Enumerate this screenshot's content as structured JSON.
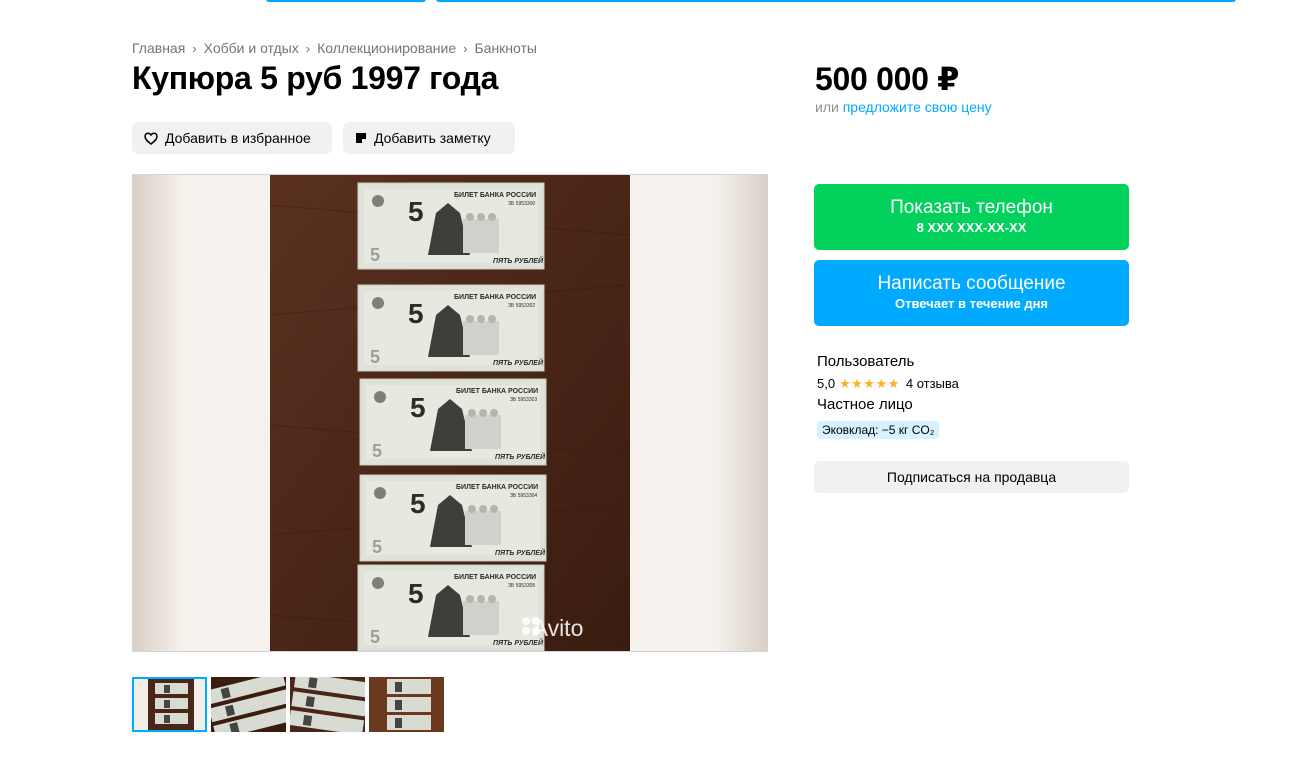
{
  "breadcrumb": [
    {
      "label": "Главная"
    },
    {
      "label": "Хобби и отдых"
    },
    {
      "label": "Коллекционирование"
    },
    {
      "label": "Банкноты"
    }
  ],
  "listing": {
    "title": "Купюра 5 руб 1997 года",
    "price": "500 000 ₽",
    "offer_prefix": "или",
    "offer_link": "предложите свою цену",
    "favorite_label": "Добавить в избранное",
    "note_label": "Добавить заметку"
  },
  "gallery": {
    "watermark": "Avito",
    "banknote_bank_text": "БИЛЕТ БАНКА РОССИИ",
    "banknote_denomination": "5",
    "banknote_words": "ПЯТЬ РУБЛЕЙ",
    "banknote_serials": [
      "ЗБ 5953300",
      "ЗБ 5953302",
      "ЗБ 5953303",
      "ЗБ 5953304",
      "ЗБ 5953305"
    ],
    "thumbnail_count": 4,
    "active_thumbnail": 1
  },
  "contact": {
    "phone_button_label": "Показать телефон",
    "phone_masked": "8 XXX XXX-XX-XX",
    "message_button_label": "Написать сообщение",
    "message_subtitle": "Отвечает в течение дня"
  },
  "seller": {
    "name": "Пользователь",
    "rating": "5,0",
    "stars": 5,
    "reviews": "4 отзыва",
    "type": "Частное лицо",
    "eco_badge": "Эковклад: −5 кг CO₂",
    "subscribe_label": "Подписаться на продавца"
  },
  "colors": {
    "accent_blue": "#00aaff",
    "phone_green": "#02d15c",
    "star_orange": "#ffb021",
    "secondary_bg": "#f2f1f0"
  }
}
